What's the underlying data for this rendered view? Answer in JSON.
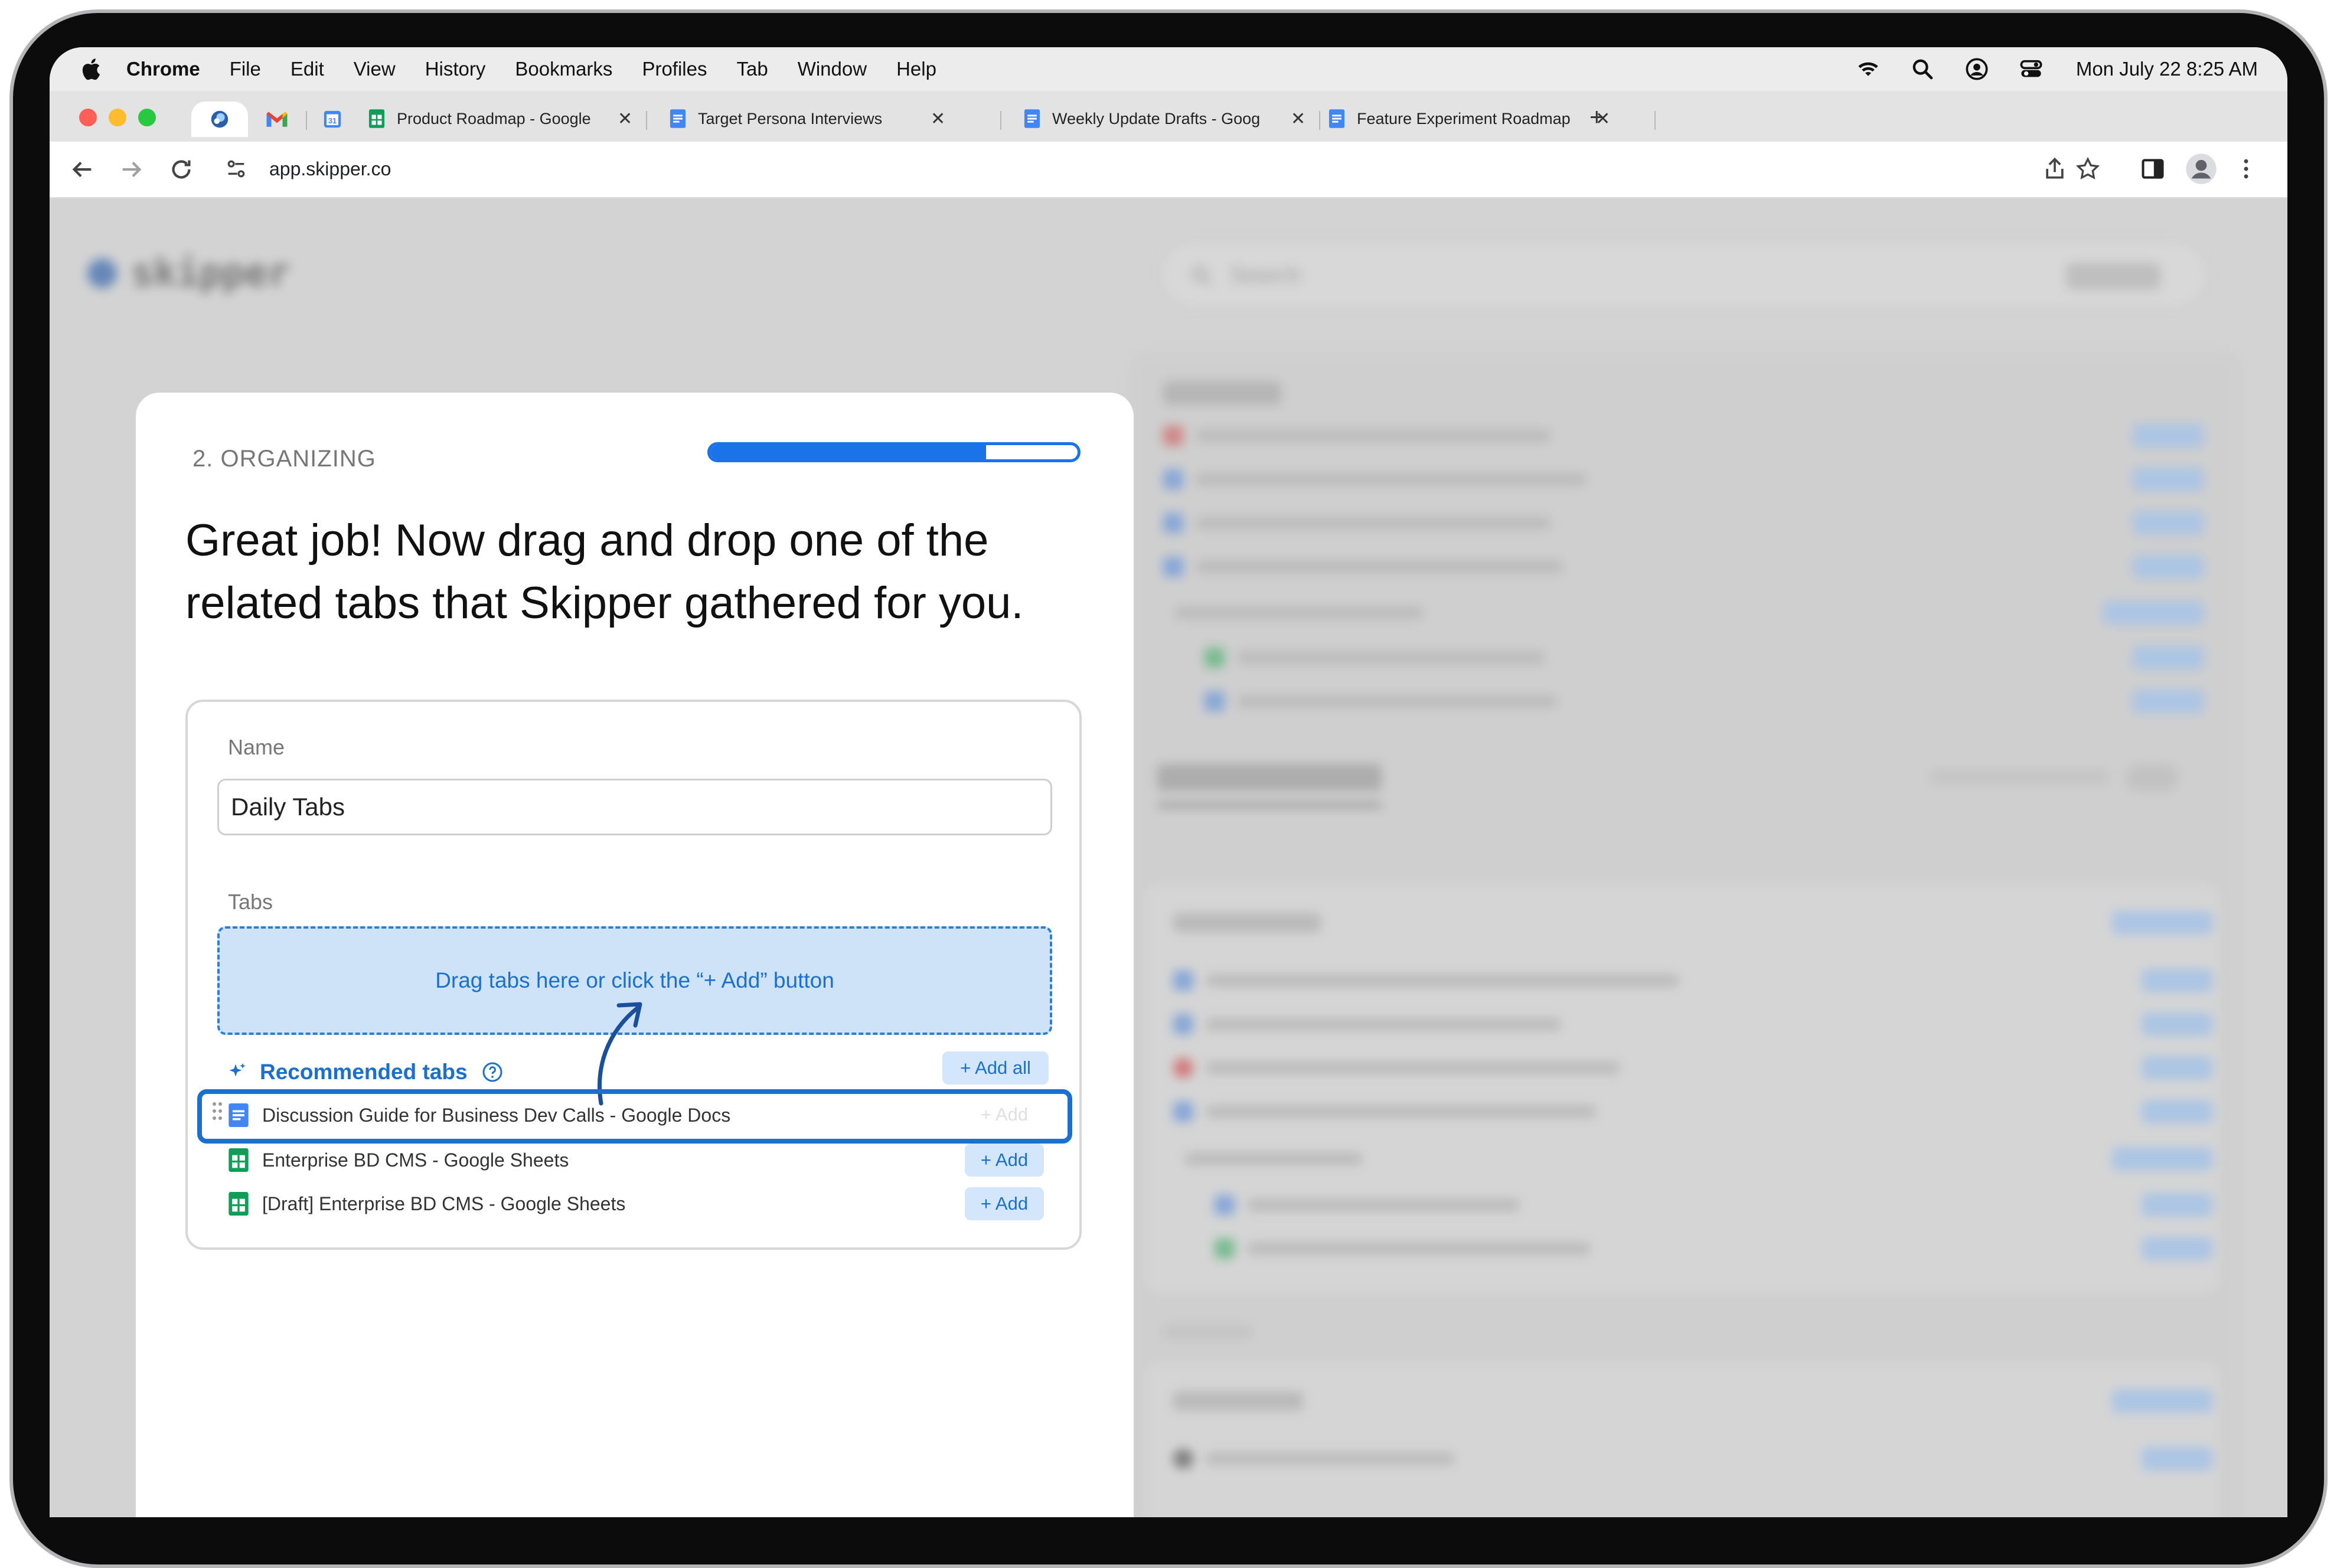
{
  "menubar": {
    "app_name": "Chrome",
    "items": [
      "File",
      "Edit",
      "View",
      "History",
      "Bookmarks",
      "Profiles",
      "Tab",
      "Window",
      "Help"
    ],
    "clock": "Mon July 22  8:25 AM"
  },
  "tabs": [
    {
      "title": "Product Roadmap - Google",
      "icon": "sheets-icon"
    },
    {
      "title": "Target Persona Interviews",
      "icon": "docs-icon"
    },
    {
      "title": "Weekly Update Drafts - Goog",
      "icon": "docs-icon"
    },
    {
      "title": "Feature Experiment Roadmap",
      "icon": "docs-icon"
    }
  ],
  "address_bar": {
    "url": "app.skipper.co"
  },
  "app": {
    "logo": "skipper",
    "search_placeholder": "Search"
  },
  "onboarding": {
    "step": "2. ORGANIZING",
    "progress": 0.75,
    "headline": "Great job! Now drag and drop one of the related tabs that Skipper gathered for you.",
    "name_label": "Name",
    "name_value": "Daily Tabs",
    "tabs_label": "Tabs",
    "dropzone_text": "Drag tabs here or click the “+ Add” button",
    "recommended_label": "Recommended tabs",
    "add_all_label": "+ Add all",
    "add_label": "+ Add",
    "recommended": [
      {
        "title": "Discussion Guide for Business Dev Calls - Google Docs",
        "icon": "docs-icon",
        "dragging": true
      },
      {
        "title": "Enterprise BD CMS - Google Sheets",
        "icon": "sheets-icon"
      },
      {
        "title": "[Draft] Enterprise BD CMS - Google Sheets",
        "icon": "sheets-icon"
      }
    ]
  },
  "colors": {
    "accent": "#1a73e8",
    "dropzone_bg": "#cfe3f8",
    "docs_blue": "#4285f4",
    "sheets_green": "#0f9d58"
  }
}
